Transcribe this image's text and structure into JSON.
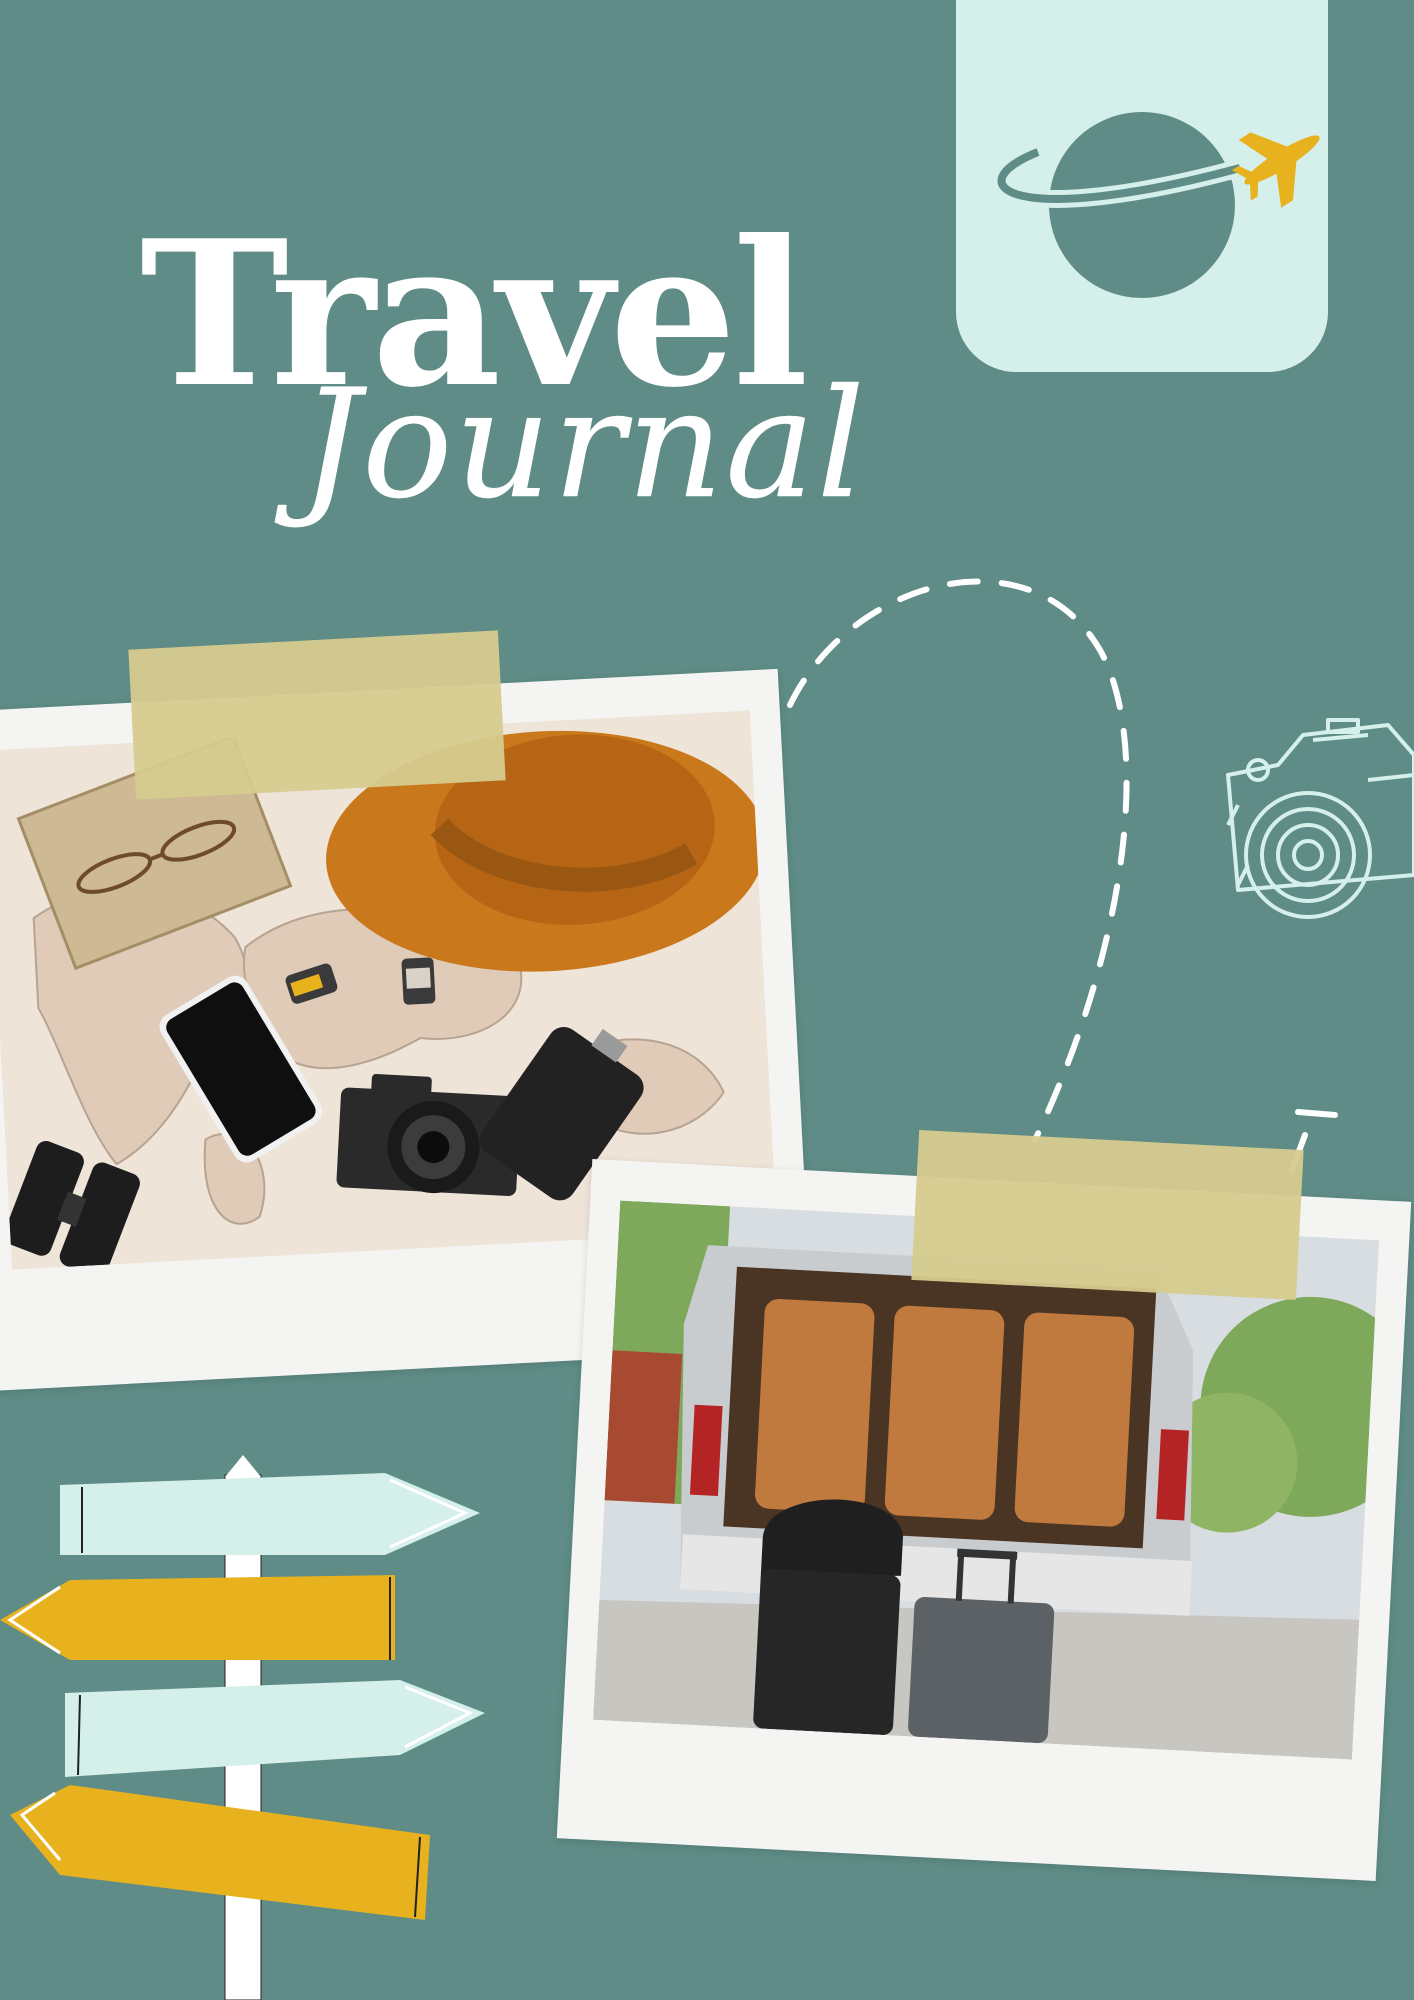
{
  "colors": {
    "background": "#5f8c86",
    "accent_light": "#d5efeb",
    "accent_yellow": "#e8b21f",
    "tape": "#d6cb8e",
    "card": "#f4f4f2"
  },
  "title": {
    "line1": "Travel",
    "line2": "Journal"
  },
  "icons": {
    "logo": "planet-with-airplane-icon",
    "camera": "camera-outline-icon",
    "signpost": "direction-signpost-icon",
    "path": "dashed-flight-path"
  },
  "photos": [
    {
      "subject": "flat-lay-map-hat-camera"
    },
    {
      "subject": "van-trunk-with-luggage"
    }
  ]
}
